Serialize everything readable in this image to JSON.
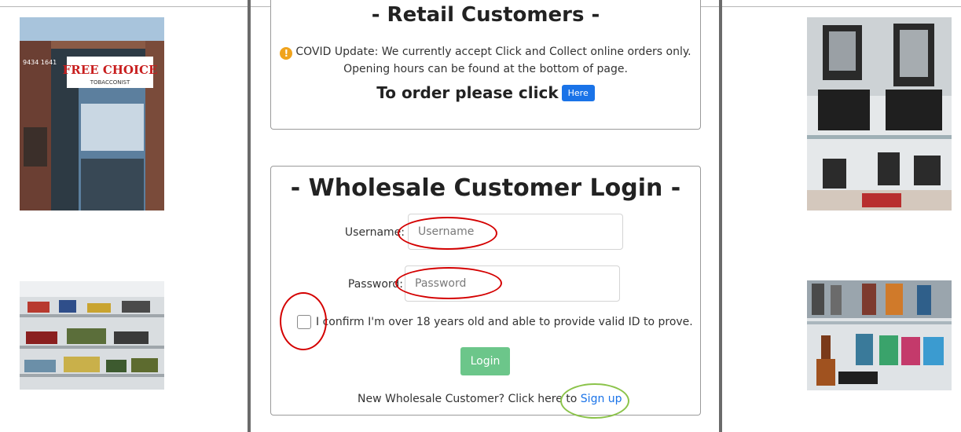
{
  "retail": {
    "title": "- Retail Customers -",
    "covid_line1": "COVID Update: We currently accept Click and Collect online orders only.",
    "covid_line2": "Opening hours can be found at the bottom of page.",
    "order_text": "To order please click",
    "here_button": "Here"
  },
  "wholesale": {
    "title": "- Wholesale Customer Login -",
    "username_label": "Username:",
    "username_placeholder": "Username",
    "password_label": "Password:",
    "password_placeholder": "Password",
    "age_confirm": "I confirm I'm over 18 years old and able to provide valid ID to prove.",
    "login_button": "Login",
    "new_customer_text": "New Wholesale Customer? Click here to",
    "signup_link": "Sign up"
  },
  "storefront_sign": {
    "brand": "FREE CHOICE",
    "subtitle": "TOBACCONIST",
    "phone": "9434 1641"
  },
  "colors": {
    "link_blue": "#1a73e8",
    "login_green": "#6cc68a",
    "warning_orange": "#f0a31c",
    "annotation_red": "#d40000",
    "annotation_green": "#8bc34a"
  }
}
